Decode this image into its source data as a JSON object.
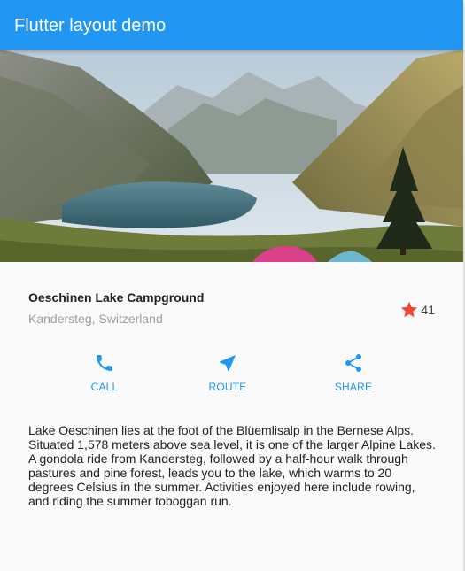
{
  "app_bar": {
    "title": "Flutter layout demo"
  },
  "hero_image": {
    "icon": "mountain-lake-photo"
  },
  "place": {
    "name": "Oeschinen Lake Campground",
    "location": "Kandersteg, Switzerland",
    "rating_count": "41",
    "star_color": "#f44336"
  },
  "actions": [
    {
      "label": "CALL",
      "icon": "phone-icon"
    },
    {
      "label": "ROUTE",
      "icon": "navigation-icon"
    },
    {
      "label": "SHARE",
      "icon": "share-icon"
    }
  ],
  "description": "Lake Oeschinen lies at the foot of the Blüemlisalp in the Bernese Alps. Situated 1,578 meters above sea level, it is one of the larger Alpine Lakes. A gondola ride from Kandersteg, followed by a half-hour walk through pastures and pine forest, leads you to the lake, which warms to 20 degrees Celsius in the summer. Activities enjoyed here include rowing, and riding the summer toboggan run.",
  "colors": {
    "primary": "#2196f3",
    "background": "#fafafa"
  }
}
